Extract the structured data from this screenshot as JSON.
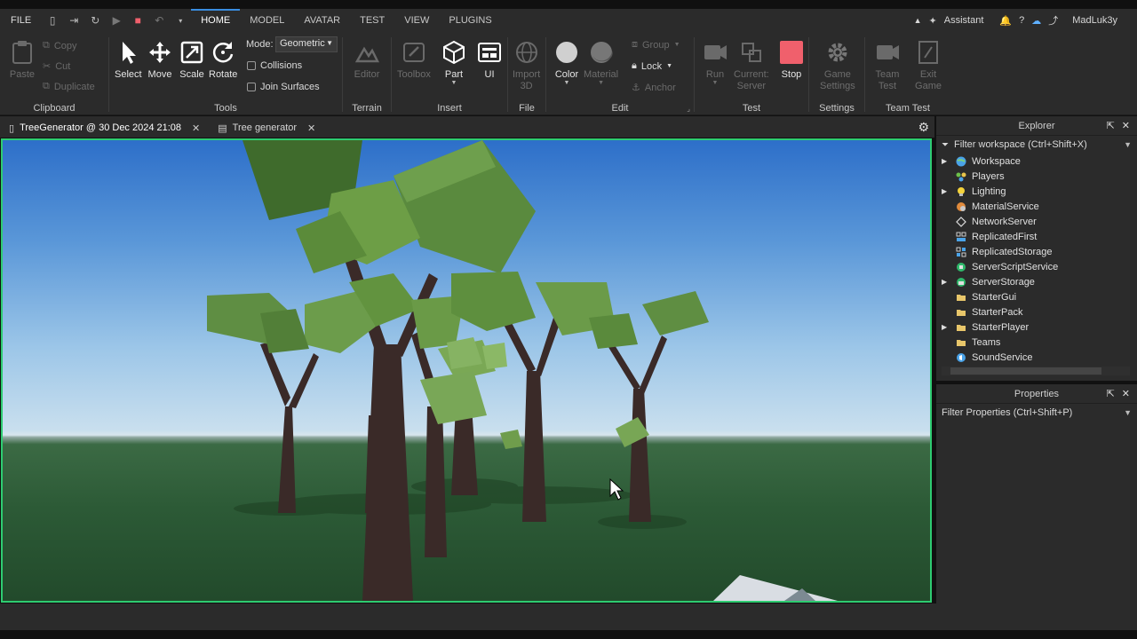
{
  "menubar": {
    "file": "FILE",
    "tabs": [
      "HOME",
      "MODEL",
      "AVATAR",
      "TEST",
      "VIEW",
      "PLUGINS"
    ],
    "active_tab": "HOME",
    "assistant": "Assistant",
    "username": "MadLuk3y"
  },
  "ribbon": {
    "clipboard": {
      "label": "Clipboard",
      "paste": "Paste",
      "copy": "Copy",
      "cut": "Cut",
      "duplicate": "Duplicate"
    },
    "tools": {
      "label": "Tools",
      "select": "Select",
      "move": "Move",
      "scale": "Scale",
      "rotate": "Rotate",
      "mode_label": "Mode:",
      "mode_value": "Geometric",
      "collisions": "Collisions",
      "join_surfaces": "Join Surfaces"
    },
    "terrain": {
      "label": "Terrain",
      "editor": "Editor"
    },
    "insert": {
      "label": "Insert",
      "toolbox": "Toolbox",
      "part": "Part",
      "ui": "UI"
    },
    "file": {
      "label": "File",
      "import3d_line1": "Import",
      "import3d_line2": "3D"
    },
    "edit": {
      "label": "Edit",
      "color": "Color",
      "material": "Material",
      "group": "Group",
      "lock": "Lock",
      "anchor": "Anchor"
    },
    "test": {
      "label": "Test",
      "run": "Run",
      "current_line1": "Current:",
      "current_line2": "Server",
      "stop": "Stop"
    },
    "settings": {
      "label": "Settings",
      "game_line1": "Game",
      "game_line2": "Settings"
    },
    "team_test": {
      "label": "Team Test",
      "team_line1": "Team",
      "team_line2": "Test",
      "exit_line1": "Exit",
      "exit_line2": "Game"
    }
  },
  "doc_tabs": [
    {
      "title": "TreeGenerator @ 30 Dec 2024 21:08"
    },
    {
      "title": "Tree generator"
    }
  ],
  "explorer": {
    "title": "Explorer",
    "filter": "Filter workspace (Ctrl+Shift+X)",
    "items": [
      {
        "label": "Workspace",
        "expandable": true
      },
      {
        "label": "Players",
        "expandable": false
      },
      {
        "label": "Lighting",
        "expandable": true
      },
      {
        "label": "MaterialService",
        "expandable": false
      },
      {
        "label": "NetworkServer",
        "expandable": false
      },
      {
        "label": "ReplicatedFirst",
        "expandable": false
      },
      {
        "label": "ReplicatedStorage",
        "expandable": false
      },
      {
        "label": "ServerScriptService",
        "expandable": false
      },
      {
        "label": "ServerStorage",
        "expandable": true
      },
      {
        "label": "StarterGui",
        "expandable": false
      },
      {
        "label": "StarterPack",
        "expandable": false
      },
      {
        "label": "StarterPlayer",
        "expandable": true
      },
      {
        "label": "Teams",
        "expandable": false
      },
      {
        "label": "SoundService",
        "expandable": false
      }
    ]
  },
  "properties": {
    "title": "Properties",
    "filter": "Filter Properties (Ctrl+Shift+P)"
  },
  "colors": {
    "accent": "#3a8de0",
    "viewport_border": "#2ecc71",
    "stop": "#f0606c",
    "panel_bg": "#2b2b2b"
  }
}
